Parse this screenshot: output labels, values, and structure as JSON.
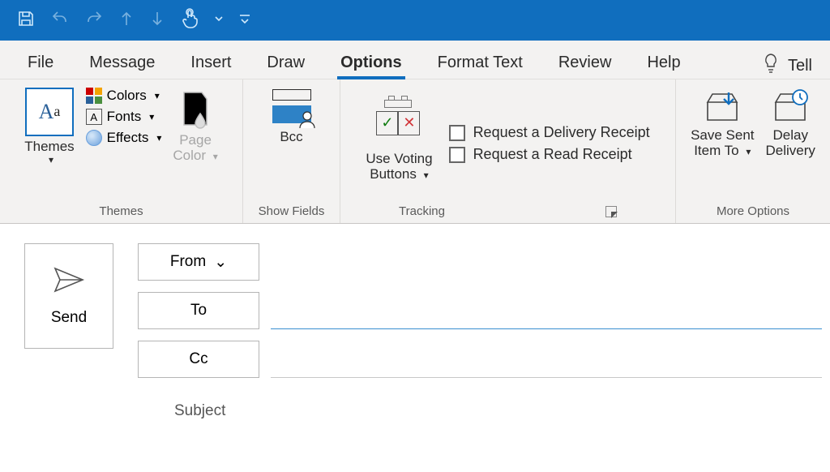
{
  "qat": {
    "save": "Save",
    "undo": "Undo",
    "redo": "Redo",
    "up": "Previous Item",
    "down": "Next Item",
    "touch": "Touch/Mouse Mode",
    "customize": "Customize Quick Access Toolbar"
  },
  "tabs": {
    "file": "File",
    "message": "Message",
    "insert": "Insert",
    "draw": "Draw",
    "options": "Options",
    "format_text": "Format Text",
    "review": "Review",
    "help": "Help",
    "tell": "Tell"
  },
  "ribbon": {
    "themes": {
      "themes_btn": "Themes",
      "colors": "Colors",
      "fonts": "Fonts",
      "effects": "Effects",
      "page_color": "Page Color",
      "group_label": "Themes"
    },
    "show_fields": {
      "bcc": "Bcc",
      "group_label": "Show Fields"
    },
    "tracking": {
      "voting": "Use Voting Buttons",
      "delivery": "Request a Delivery Receipt",
      "read": "Request a Read Receipt",
      "group_label": "Tracking"
    },
    "more": {
      "save_sent": "Save Sent Item To",
      "delay": "Delay Delivery",
      "group_label": "More Options"
    }
  },
  "compose": {
    "send": "Send",
    "from": "From",
    "to": "To",
    "cc": "Cc",
    "subject_label": "Subject",
    "to_value": "",
    "cc_value": "",
    "subject_value": ""
  }
}
